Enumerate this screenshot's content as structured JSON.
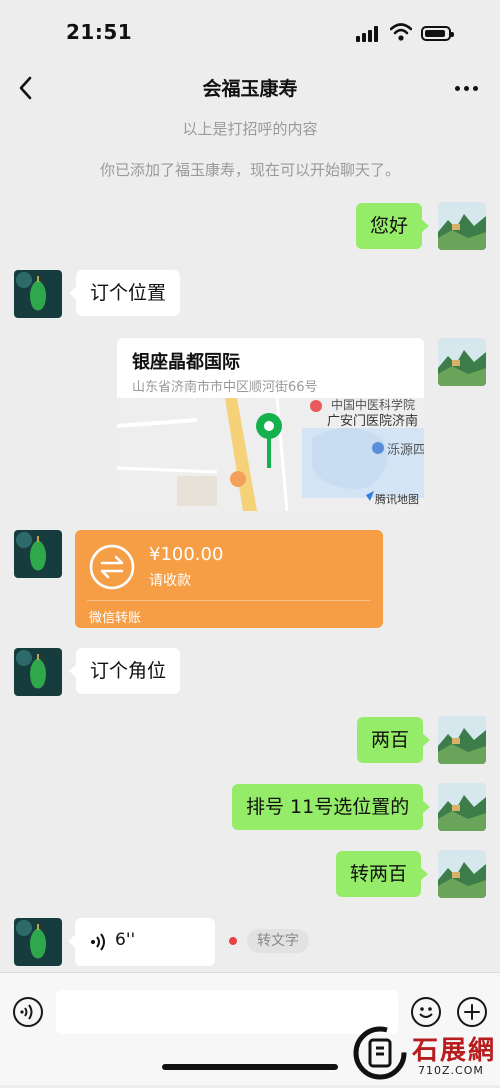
{
  "status_bar": {
    "time": "21:51"
  },
  "nav": {
    "title": "会福玉康寿"
  },
  "system_messages": [
    "以上是打招呼的内容",
    "你已添加了福玉康寿，现在可以开始聊天了。"
  ],
  "messages": {
    "hello": "您好",
    "book_location": "订个位置",
    "book_spot": "订个角位",
    "two_hundred": "两百",
    "queue_number": "排号 11号选位置的",
    "transfer_two_hundred": "转两百"
  },
  "location": {
    "title": "银座晶都国际",
    "address": "山东省济南市市中区顺河街66号",
    "map_label_1": "中国中医科学院",
    "map_label_2": "广安门医院济南",
    "map_label_3": "泺源四",
    "map_provider": "腾讯地图"
  },
  "transfer": {
    "amount": "¥100.00",
    "desc": "请收款",
    "footer": "微信转账"
  },
  "voice": {
    "duration": "6''",
    "to_text": "转文字"
  },
  "watermark": {
    "text": "石展網",
    "url": "710Z.COM"
  },
  "icons": [
    "back-icon",
    "more-icon",
    "voice-input-icon",
    "emoji-icon",
    "plus-icon",
    "transfer-icon",
    "voice-wave-icon"
  ]
}
